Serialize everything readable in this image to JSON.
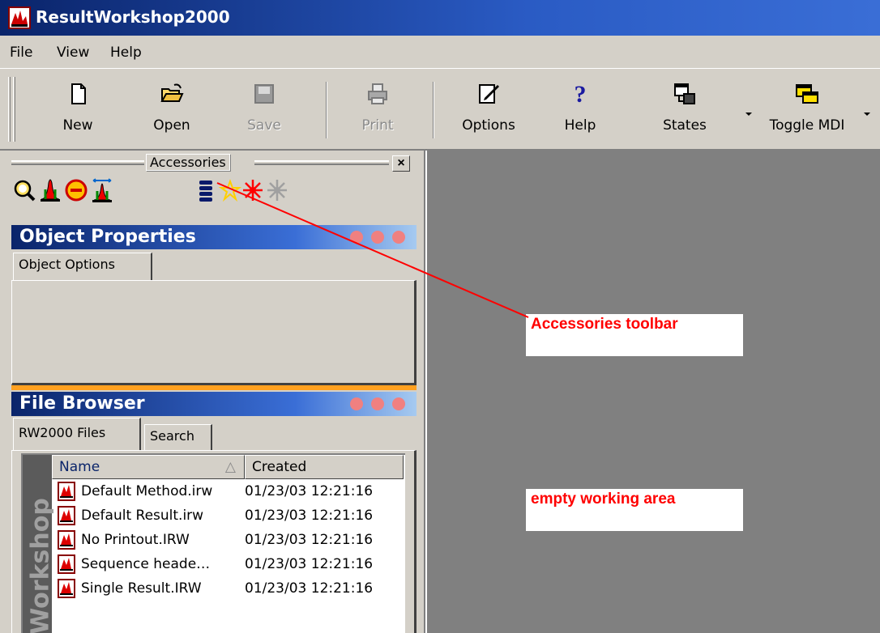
{
  "window": {
    "title": "ResultWorkshop2000"
  },
  "menu": {
    "items": [
      "File",
      "View",
      "Help"
    ]
  },
  "toolbar": {
    "buttons": [
      {
        "label": "New",
        "icon": "new-document-icon"
      },
      {
        "label": "Open",
        "icon": "open-folder-icon"
      },
      {
        "label": "Save",
        "icon": "save-disk-icon",
        "disabled": true
      },
      {
        "label": "Print",
        "icon": "printer-icon",
        "disabled": true
      },
      {
        "label": "Options",
        "icon": "options-pencil-icon"
      },
      {
        "label": "Help",
        "icon": "help-question-icon"
      },
      {
        "label": "States",
        "icon": "states-icon"
      },
      {
        "label": "Toggle MDI",
        "icon": "toggle-mdi-icon"
      }
    ]
  },
  "accessories": {
    "title": "Accessories",
    "close_label": "×",
    "icons": [
      "zoom-icon",
      "peak-icon",
      "no-entry-icon",
      "peak-width-icon",
      "stack-icon",
      "yellow-star-icon",
      "red-star-icon",
      "gray-star-icon"
    ]
  },
  "object_properties": {
    "title": "Object Properties",
    "tab": "Object Options"
  },
  "file_browser": {
    "title": "File Browser",
    "tabs": [
      "RW2000 Files",
      "Search"
    ],
    "side_label": "Workshop",
    "columns": [
      "Name",
      "Created"
    ],
    "sort_indicator": "△",
    "rows": [
      {
        "name": "Default Method.irw",
        "created": "01/23/03 12:21:16"
      },
      {
        "name": "Default Result.irw",
        "created": "01/23/03 12:21:16"
      },
      {
        "name": "No Printout.IRW",
        "created": "01/23/03 12:21:16"
      },
      {
        "name": "Sequence heade…",
        "created": "01/23/03 12:21:16"
      },
      {
        "name": "Single Result.IRW",
        "created": "01/23/03 12:21:16"
      }
    ]
  },
  "annotations": {
    "accessories_toolbar": "Accessories toolbar",
    "empty_working_area": "empty working area"
  },
  "colors": {
    "titlebar": "#0a246a",
    "chrome": "#d4d0c8",
    "workarea": "#808080",
    "annotation_text": "#ff0000",
    "divider": "#ffa020"
  }
}
